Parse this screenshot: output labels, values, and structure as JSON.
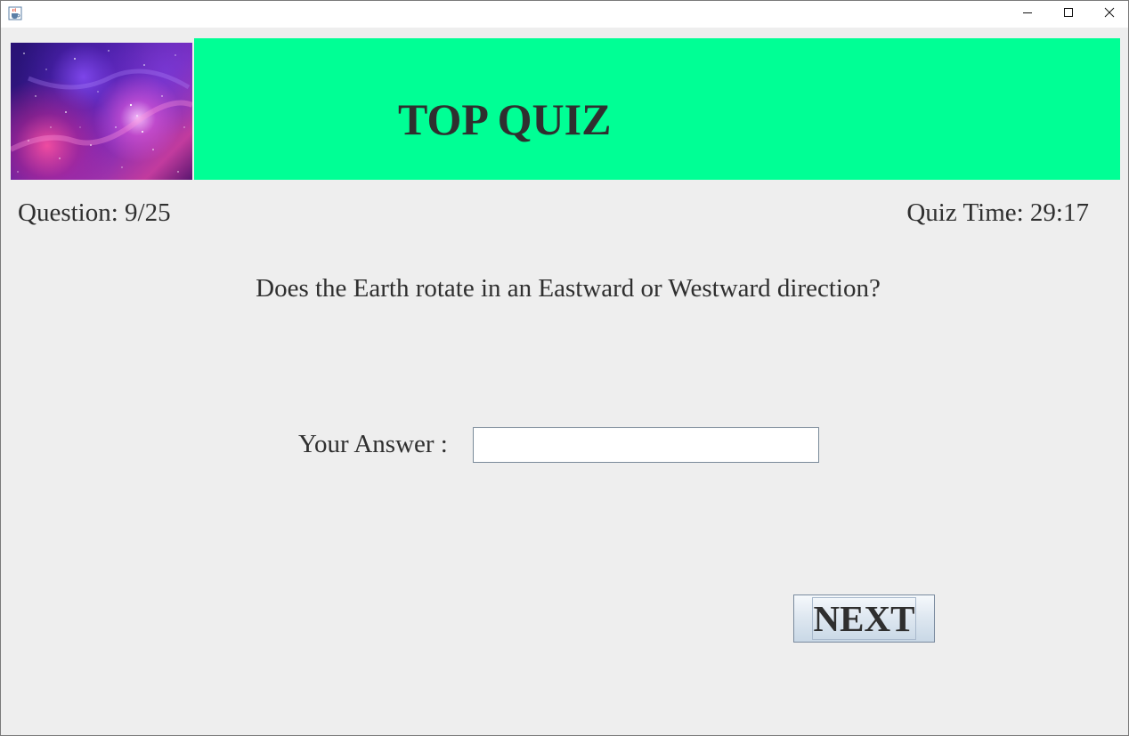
{
  "window": {
    "icon": "java-cup-icon",
    "controls": {
      "minimize_icon": "minimize-icon",
      "maximize_icon": "maximize-icon",
      "close_icon": "close-icon"
    }
  },
  "header": {
    "image": "galaxy-nebula-image",
    "title": "TOP QUIZ",
    "band_color": "#00ff95"
  },
  "status": {
    "question_counter": "Question: 9/25",
    "quiz_time": "Quiz Time: 29:17"
  },
  "question": {
    "text": "Does the Earth rotate in an Eastward or Westward direction?"
  },
  "answer": {
    "label": "Your Answer :",
    "value": ""
  },
  "actions": {
    "next_label": "NEXT"
  }
}
